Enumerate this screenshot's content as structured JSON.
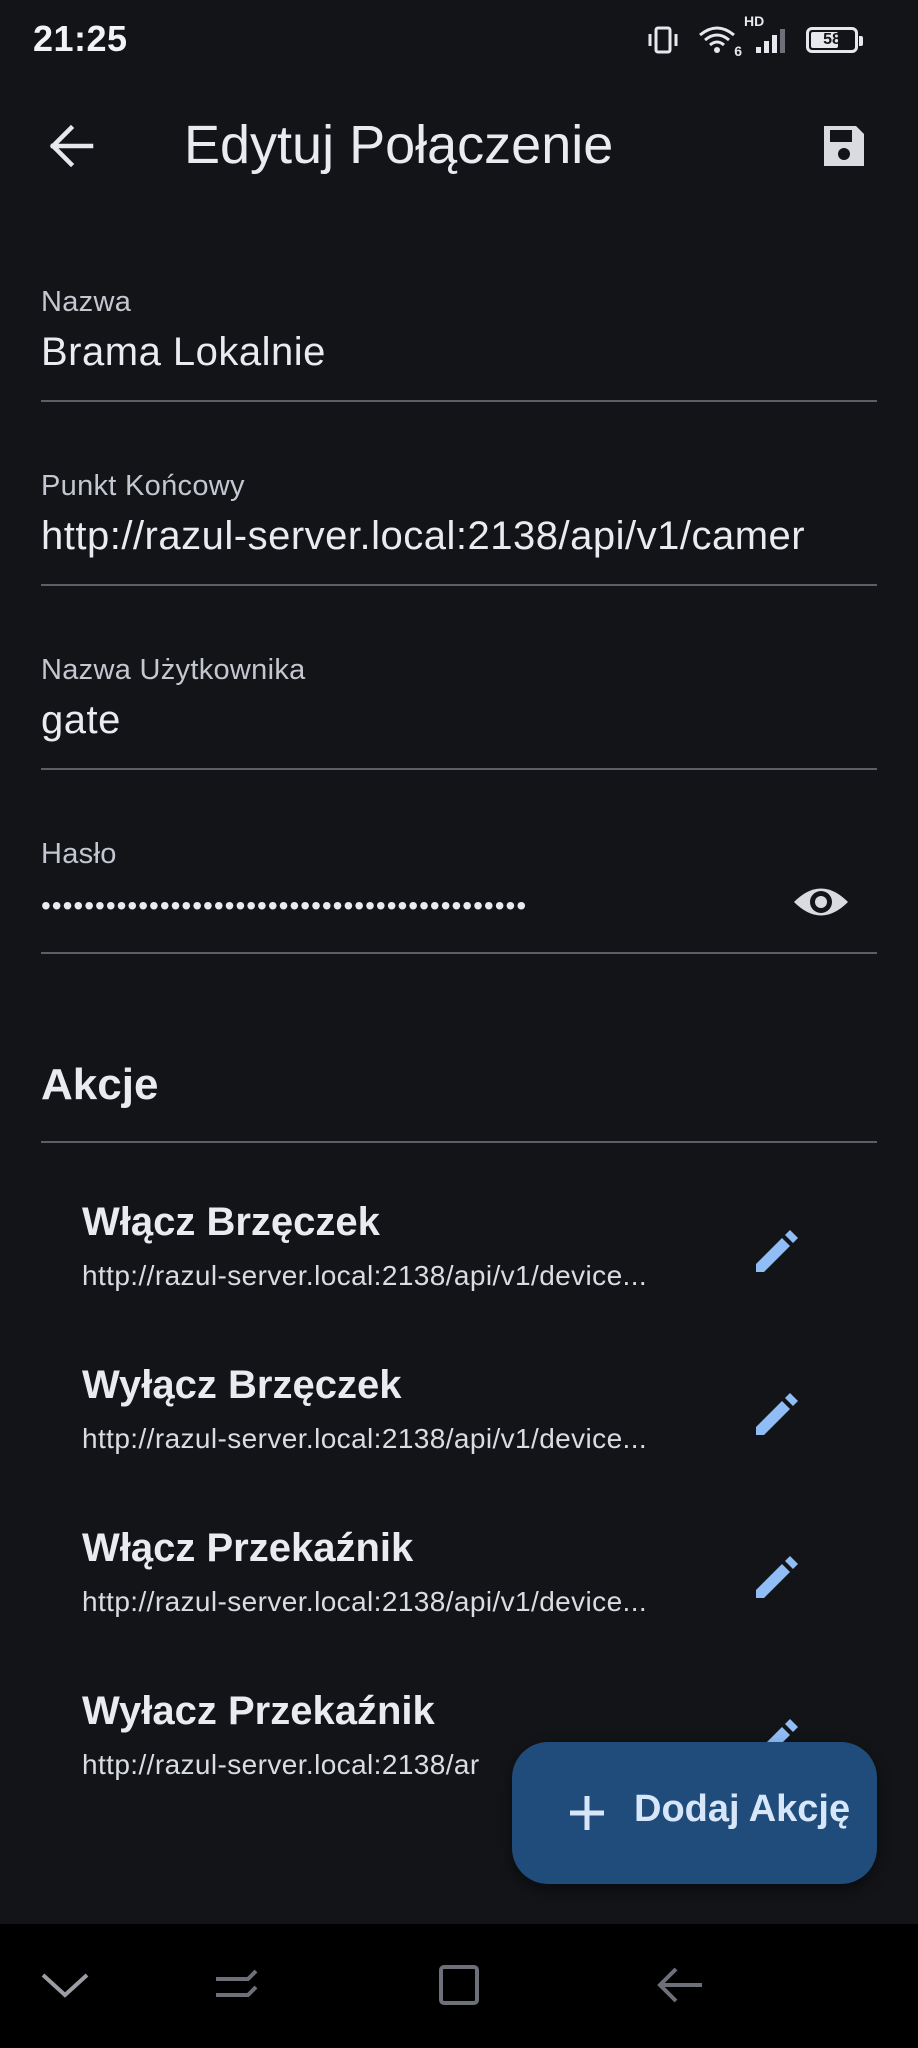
{
  "status_bar": {
    "time": "21:25",
    "network_badge": "HD",
    "wifi_badge": "6",
    "battery_level": "58"
  },
  "app_bar": {
    "back_icon": "arrow-back-icon",
    "title": "Edytuj Połączenie",
    "save_icon": "save-icon"
  },
  "form": {
    "name": {
      "label": "Nazwa",
      "value": "Brama Lokalnie"
    },
    "endpoint": {
      "label": "Punkt Końcowy",
      "value": "http://razul-server.local:2138/api/v1/camer"
    },
    "username": {
      "label": "Nazwa Użytkownika",
      "value": "gate"
    },
    "password": {
      "label": "Hasło",
      "value": "•••••••••••••••••••••••••••••••••••••••••••••",
      "visibility_icon": "eye-icon"
    }
  },
  "actions": {
    "title": "Akcje",
    "items": [
      {
        "title": "Włącz Brzęczek",
        "url": "http://razul-server.local:2138/api/v1/device..."
      },
      {
        "title": "Wyłącz Brzęczek",
        "url": "http://razul-server.local:2138/api/v1/device..."
      },
      {
        "title": "Włącz Przekaźnik",
        "url": "http://razul-server.local:2138/api/v1/device..."
      },
      {
        "title": "Wyłacz Przekaźnik",
        "url": "http://razul-server.local:2138/ar"
      }
    ]
  },
  "fab": {
    "icon": "plus-icon",
    "label": "Dodaj Akcję"
  },
  "colors": {
    "background": "#121418",
    "accent": "#90bdf5",
    "fab_background": "#1f4c7b",
    "divider": "#5b5f66"
  },
  "nav_bar": {
    "icons": [
      "chevron-down-icon",
      "recents-icon",
      "home-icon",
      "back-icon"
    ]
  }
}
